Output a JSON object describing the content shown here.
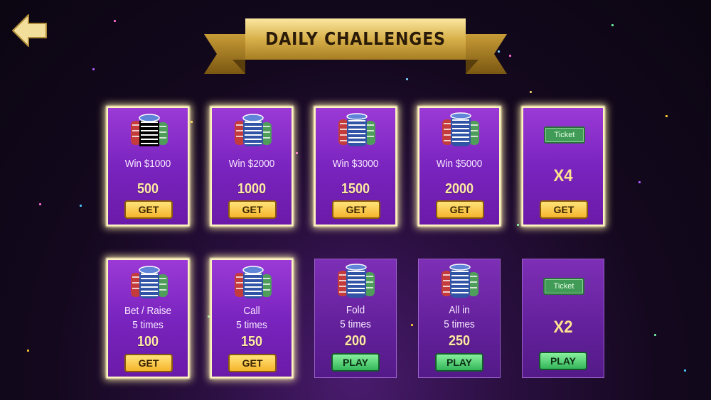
{
  "header": {
    "title": "DAILY CHALLENGES"
  },
  "back_button": {
    "icon": "arrow-left-icon"
  },
  "ticket_label": "Ticket",
  "challenges": [
    {
      "line1": "Win $1000",
      "line2": "",
      "reward": "500",
      "button": "GET"
    },
    {
      "line1": "Win $2000",
      "line2": "",
      "reward": "1000",
      "button": "GET"
    },
    {
      "line1": "Win $3000",
      "line2": "",
      "reward": "1500",
      "button": "GET"
    },
    {
      "line1": "Win $5000",
      "line2": "",
      "reward": "2000",
      "button": "GET"
    },
    {
      "multiplier": "X4",
      "button": "GET"
    },
    {
      "line1": "Bet / Raise",
      "line2": "5 times",
      "reward": "100",
      "button": "GET"
    },
    {
      "line1": "Call",
      "line2": "5 times",
      "reward": "150",
      "button": "GET"
    },
    {
      "line1": "Fold",
      "line2": "5 times",
      "reward": "200",
      "button": "PLAY"
    },
    {
      "line1": "All in",
      "line2": "5 times",
      "reward": "250",
      "button": "PLAY"
    },
    {
      "multiplier": "X2",
      "button": "PLAY"
    }
  ],
  "colors": {
    "card": "#7a24bf",
    "get_button": "#f5b52c",
    "play_button": "#34b65a",
    "ribbon": "#d9b54f"
  }
}
